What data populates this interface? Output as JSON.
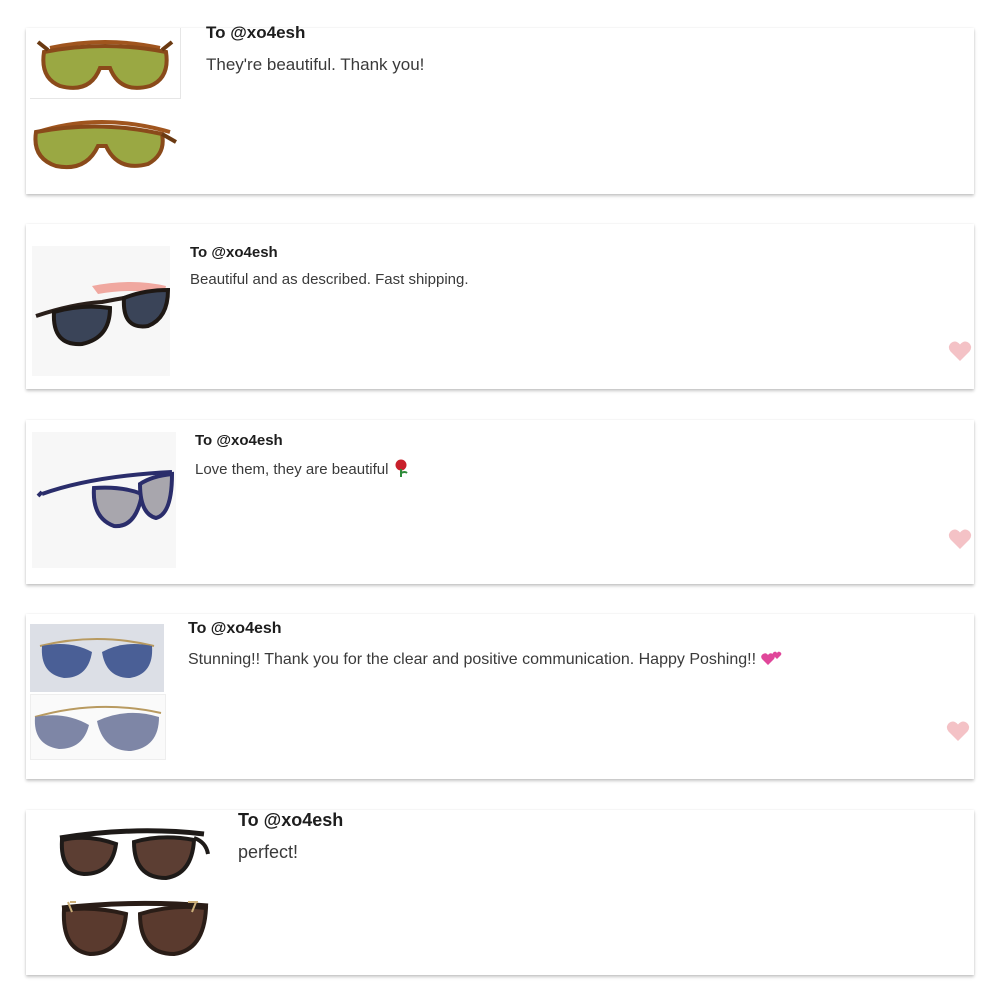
{
  "reviews": [
    {
      "recipient": "To @xo4esh",
      "message": "They're beautiful. Thank you!",
      "liked": false,
      "images": [
        "aviator-sunglasses-green-lens-front",
        "aviator-sunglasses-green-lens-side"
      ]
    },
    {
      "recipient": "To @xo4esh",
      "message": "Beautiful and as described. Fast shipping.",
      "liked": true,
      "images": [
        "cat-eye-sunglasses-pink-temples"
      ]
    },
    {
      "recipient": "To @xo4esh",
      "message": "Love them, they are beautiful",
      "emoji": "rose",
      "liked": true,
      "images": [
        "navy-cat-eye-sunglasses"
      ]
    },
    {
      "recipient": "To @xo4esh",
      "message": "Stunning!! Thank you for the clear and positive communication. Happy Poshing!!",
      "emoji": "two-hearts",
      "liked": true,
      "images": [
        "gold-aviator-sunglasses-blue-gradient-front",
        "gold-aviator-sunglasses-blue-gradient-side"
      ]
    },
    {
      "recipient": "To @xo4esh",
      "message": "perfect!",
      "liked": false,
      "images": [
        "tortoise-rectangular-sunglasses-side",
        "tortoise-rectangular-sunglasses-front"
      ]
    }
  ],
  "colors": {
    "heart": "#f4c2c6",
    "card_shadow": "#cccccc"
  }
}
